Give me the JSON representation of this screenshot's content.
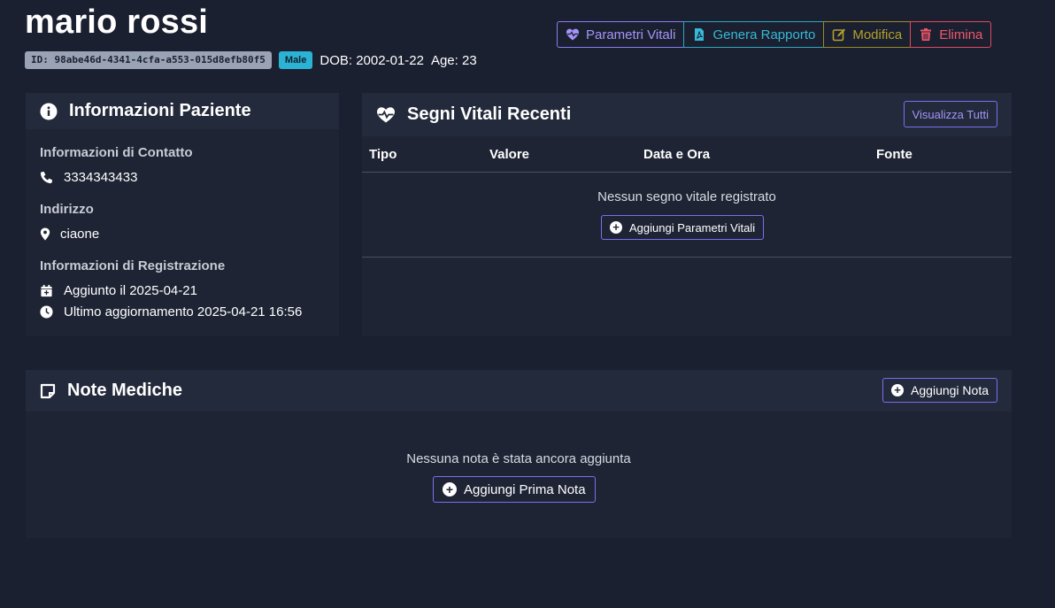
{
  "patient": {
    "name": "mario rossi",
    "id_label": "ID: 98abe46d-4341-4cfa-a553-015d8efb80f5",
    "sex": "Male",
    "dob": "DOB: 2002-01-22",
    "age": "Age: 23"
  },
  "actions": {
    "vitals": "Parametri Vitali",
    "report": "Genera Rapporto",
    "edit": "Modifica",
    "delete": "Elimina"
  },
  "info": {
    "title": "Informazioni Paziente",
    "contact_label": "Informazioni di Contatto",
    "phone": "3334343433",
    "address_label": "Indirizzo",
    "address": "ciaone",
    "registration_label": "Informazioni di Registrazione",
    "added": "Aggiunto il 2025-04-21",
    "updated": "Ultimo aggiornamento 2025-04-21 16:56"
  },
  "vitals": {
    "title": "Segni Vitali Recenti",
    "view_all": "Visualizza Tutti",
    "columns": [
      "Tipo",
      "Valore",
      "Data e Ora",
      "Fonte"
    ],
    "empty": "Nessun segno vitale registrato",
    "add_button": "Aggiungi Parametri Vitali"
  },
  "notes": {
    "title": "Note Mediche",
    "add_button": "Aggiungi Nota",
    "empty": "Nessuna nota è stata ancora aggiunta",
    "add_first_button": "Aggiungi Prima Nota"
  },
  "colors": {
    "background": "#1b2030",
    "primary": "#8c7cf0",
    "info": "#2fa7c4",
    "warning": "#9c8b25",
    "danger": "#e04a5d"
  },
  "icons": {
    "vitals": "heart-pulse-icon",
    "report": "file-pdf-icon",
    "edit": "edit-icon",
    "delete": "trash-icon",
    "info": "info-circle-icon",
    "phone": "phone-icon",
    "address": "map-marker-icon",
    "added": "calendar-plus-icon",
    "updated": "clock-icon",
    "notes": "sticky-note-icon",
    "add": "plus-circle-icon"
  }
}
